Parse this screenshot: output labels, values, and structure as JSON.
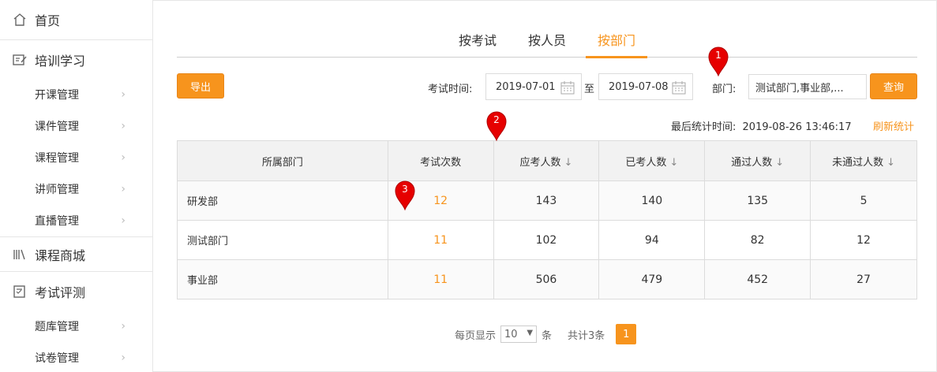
{
  "sidebar": {
    "home": "首页",
    "training": "培训学习",
    "training_items": [
      "开课管理",
      "课件管理",
      "课程管理",
      "讲师管理",
      "直播管理"
    ],
    "mall": "课程商城",
    "exam": "考试评测",
    "exam_items": [
      "题库管理",
      "试卷管理"
    ]
  },
  "tabs": [
    "按考试",
    "按人员",
    "按部门"
  ],
  "active_tab": "按部门",
  "toolbar": {
    "export_label": "导出",
    "exam_time_label": "考试时间:",
    "date_from": "2019-07-01",
    "to_label": "至",
    "date_to": "2019-07-08",
    "dept_label": "部门:",
    "dept_value": "测试部门,事业部,...",
    "query_label": "查询"
  },
  "stats": {
    "last_label": "最后统计时间:",
    "last_time": "2019-08-26 13:46:17",
    "refresh_label": "刷新统计"
  },
  "table": {
    "headers": [
      "所属部门",
      "考试次数",
      "应考人数",
      "已考人数",
      "通过人数",
      "未通过人数"
    ],
    "rows": [
      [
        "研发部",
        "12",
        "143",
        "140",
        "135",
        "5"
      ],
      [
        "测试部门",
        "11",
        "102",
        "94",
        "82",
        "12"
      ],
      [
        "事业部",
        "11",
        "506",
        "479",
        "452",
        "27"
      ]
    ]
  },
  "pagination": {
    "per_page_label": "每页显示",
    "per_page_value": "10",
    "unit_label": "条",
    "total_label": "共计3条",
    "current_page": "1"
  },
  "markers": [
    "1",
    "2",
    "3"
  ],
  "colors": {
    "accent": "#f7941d",
    "marker": "#e60000"
  }
}
